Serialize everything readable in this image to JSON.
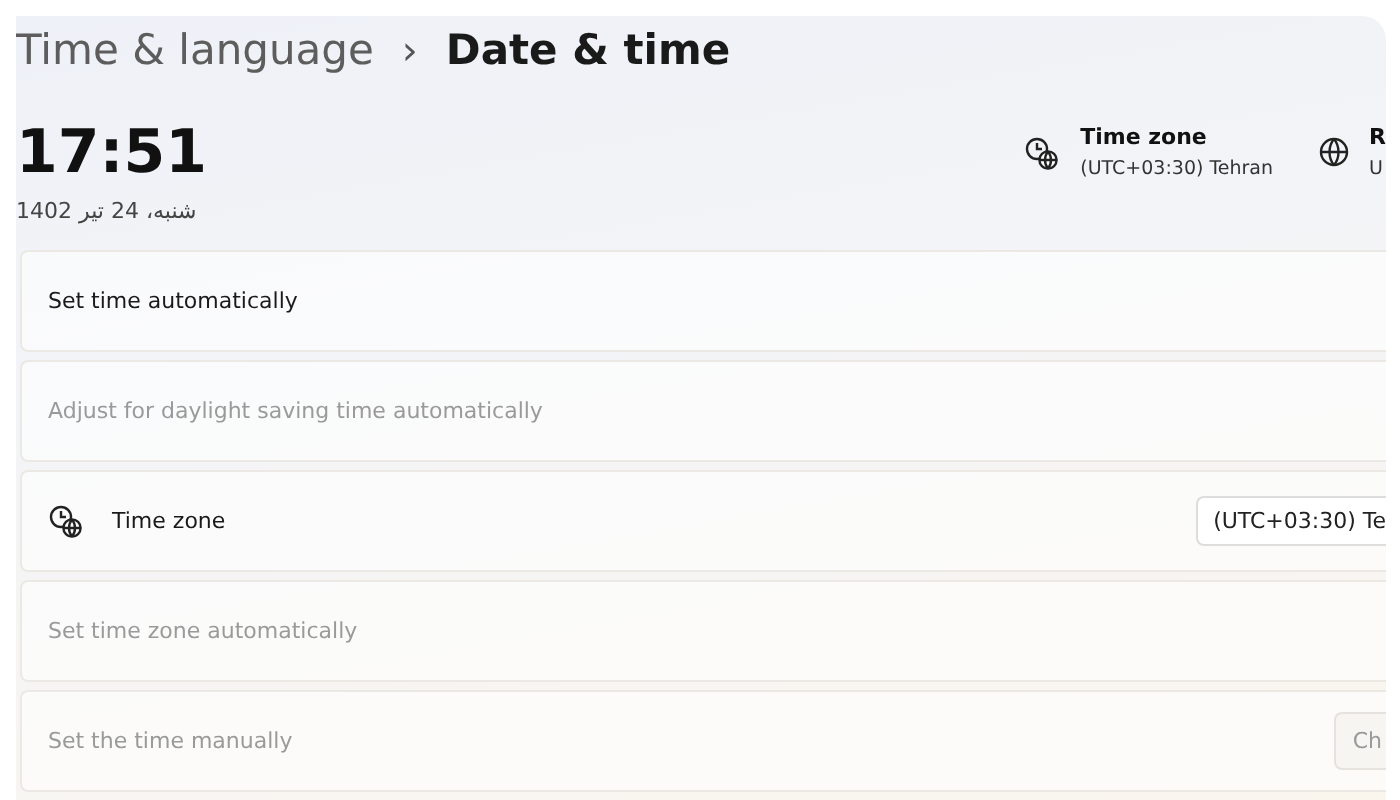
{
  "breadcrumb": {
    "parent": "Time & language",
    "separator": "›",
    "current": "Date & time"
  },
  "clock": {
    "time": "17:51",
    "date": "شنبه، 24 تیر 1402"
  },
  "info": [
    {
      "kind": "clock-globe",
      "title": "Time zone",
      "value": "(UTC+03:30) Tehran"
    },
    {
      "kind": "globe",
      "title": "R",
      "value": "U"
    }
  ],
  "rows": [
    {
      "kind": "plain",
      "label": "Set time automatically",
      "disabled": false
    },
    {
      "kind": "plain",
      "label": "Adjust for daylight saving time automatically",
      "disabled": true
    },
    {
      "kind": "dropdown",
      "label": "Time zone",
      "value": "(UTC+03:30) Te",
      "disabled": false
    },
    {
      "kind": "plain",
      "label": "Set time zone automatically",
      "disabled": true
    },
    {
      "kind": "button",
      "label": "Set the time manually",
      "button": "Ch",
      "disabled": true
    }
  ]
}
